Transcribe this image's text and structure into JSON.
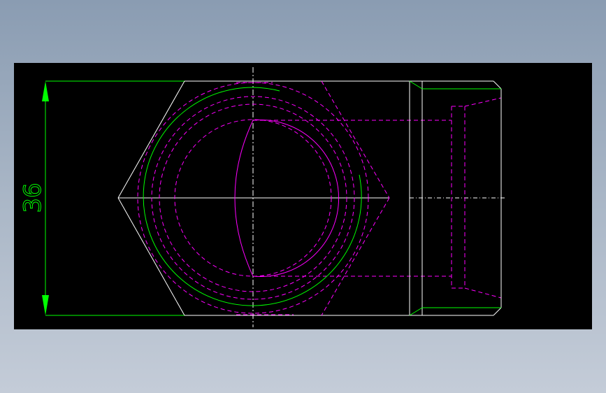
{
  "drawing": {
    "dimension_label": "36",
    "colors": {
      "background": "#000000",
      "outline": "#ffffff",
      "dimension": "#00ff00",
      "hidden": "#ff00ff",
      "thread": "#00ff00"
    }
  }
}
